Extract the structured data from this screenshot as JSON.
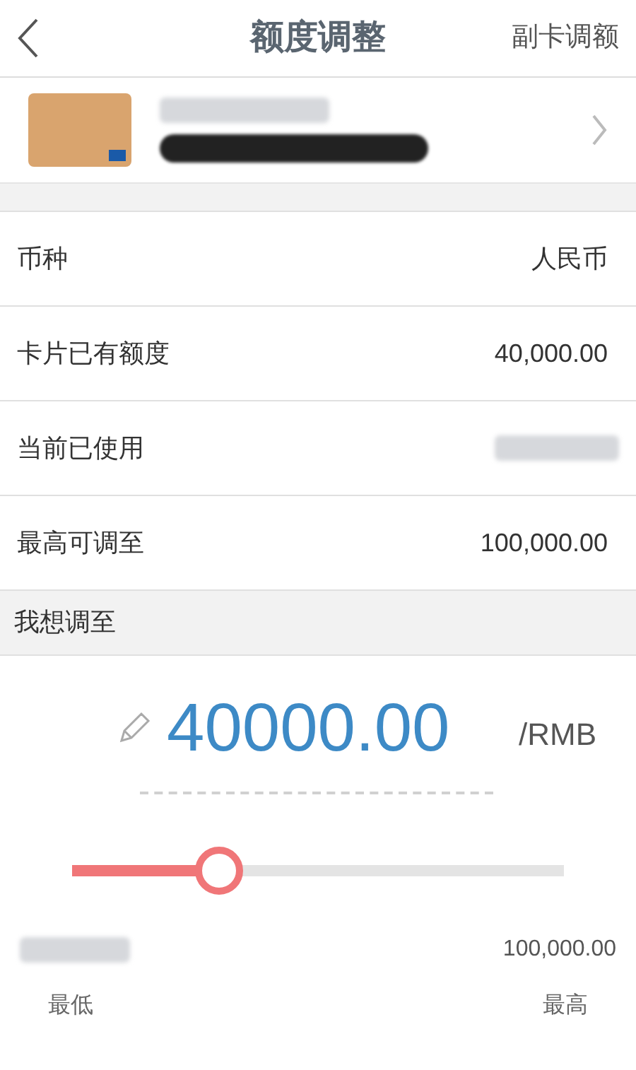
{
  "header": {
    "title": "额度调整",
    "action": "副卡调额"
  },
  "rows": [
    {
      "label": "币种",
      "value": "人民币",
      "kind": "text"
    },
    {
      "label": "卡片已有额度",
      "value": "40,000.00",
      "kind": "text"
    },
    {
      "label": "当前已使用",
      "kind": "blurred"
    },
    {
      "label": "最高可调至",
      "value": "100,000.00",
      "kind": "text"
    }
  ],
  "section": {
    "title": "我想调至"
  },
  "amount": {
    "value": "40000.00",
    "unit": "/RMB"
  },
  "slider": {
    "level": 0.3,
    "max_value": "100,000.00",
    "min_label": "最低",
    "max_label": "最高"
  }
}
